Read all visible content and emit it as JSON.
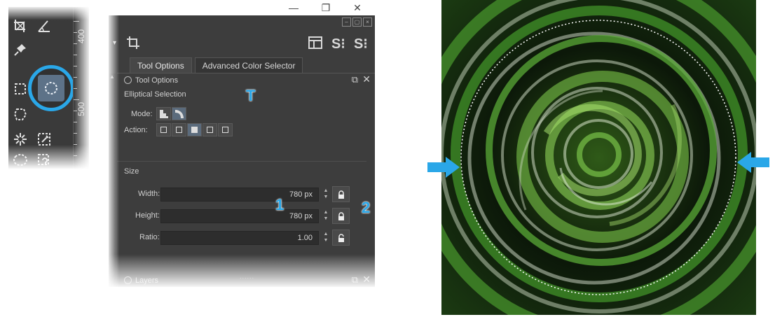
{
  "toolbox": {
    "ruler_labels": [
      "400",
      "500"
    ],
    "tools": [
      "crop-icon",
      "angle-measure-icon",
      "pin-icon",
      "rectangle-select-icon",
      "ellipse-select-icon",
      "polygon-select-icon",
      "magic-wand-icon",
      "similar-color-select-icon",
      "bezier-select-icon",
      "freehand-path-select-icon"
    ],
    "active_tool": "ellipse-select-icon",
    "highlight_color": "#2aa7e8"
  },
  "window": {
    "controls": [
      "minimize",
      "restore",
      "close"
    ],
    "toolbar": {
      "left_icon": "crop-icon",
      "right_icons": [
        "layout-icon",
        "snapshot-icon",
        "snapshot-alt-icon"
      ]
    },
    "tabs": [
      {
        "label": "Tool Options",
        "active": true
      },
      {
        "label": "Advanced Color Selector",
        "active": false
      }
    ],
    "tool_options": {
      "docker_title": "Tool Options",
      "tool_name": "Elliptical Selection",
      "mode_label": "Mode:",
      "action_label": "Action:",
      "size_heading": "Size",
      "width": {
        "label": "Width:",
        "value": "780 px"
      },
      "height": {
        "label": "Height:",
        "value": "780 px"
      },
      "ratio": {
        "label": "Ratio:",
        "value": "1.00"
      }
    },
    "layers_title": "Layers",
    "grip": "......",
    "callouts": {
      "tool": "T",
      "field": "1",
      "lock": "2"
    }
  },
  "preview": {
    "image": "green-swirl-ellipse-selection",
    "accent_color": "#2aa7e8"
  }
}
